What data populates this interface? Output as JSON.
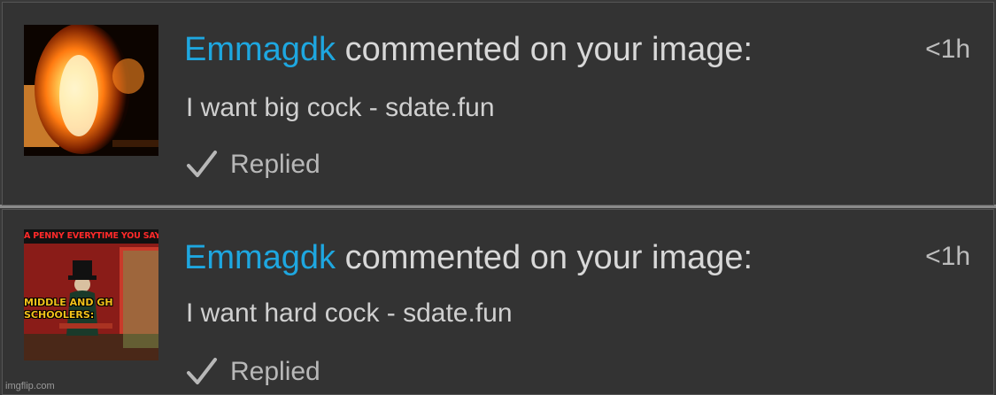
{
  "notifications": [
    {
      "username": "Emmagdk",
      "action": " commented on your image:",
      "time": "<1h",
      "message": "I want big cock - sdate.fun",
      "status": "Replied",
      "thumb_icon": "fire-image-icon"
    },
    {
      "username": "Emmagdk",
      "action": " commented on your image:",
      "time": "<1h",
      "message": "I want hard cock - sdate.fun",
      "status": "Replied",
      "thumb_icon": "meme-image-icon",
      "thumb_text_top": "A PENNY EVERYTIME YOU SAY GY",
      "thumb_text_mid": "MIDDLE AND GH SCHOOLERS:"
    }
  ],
  "watermark": "imgflip.com",
  "colors": {
    "username": "#1ea7e0",
    "background": "#333333",
    "divider": "#8a8a8a"
  }
}
